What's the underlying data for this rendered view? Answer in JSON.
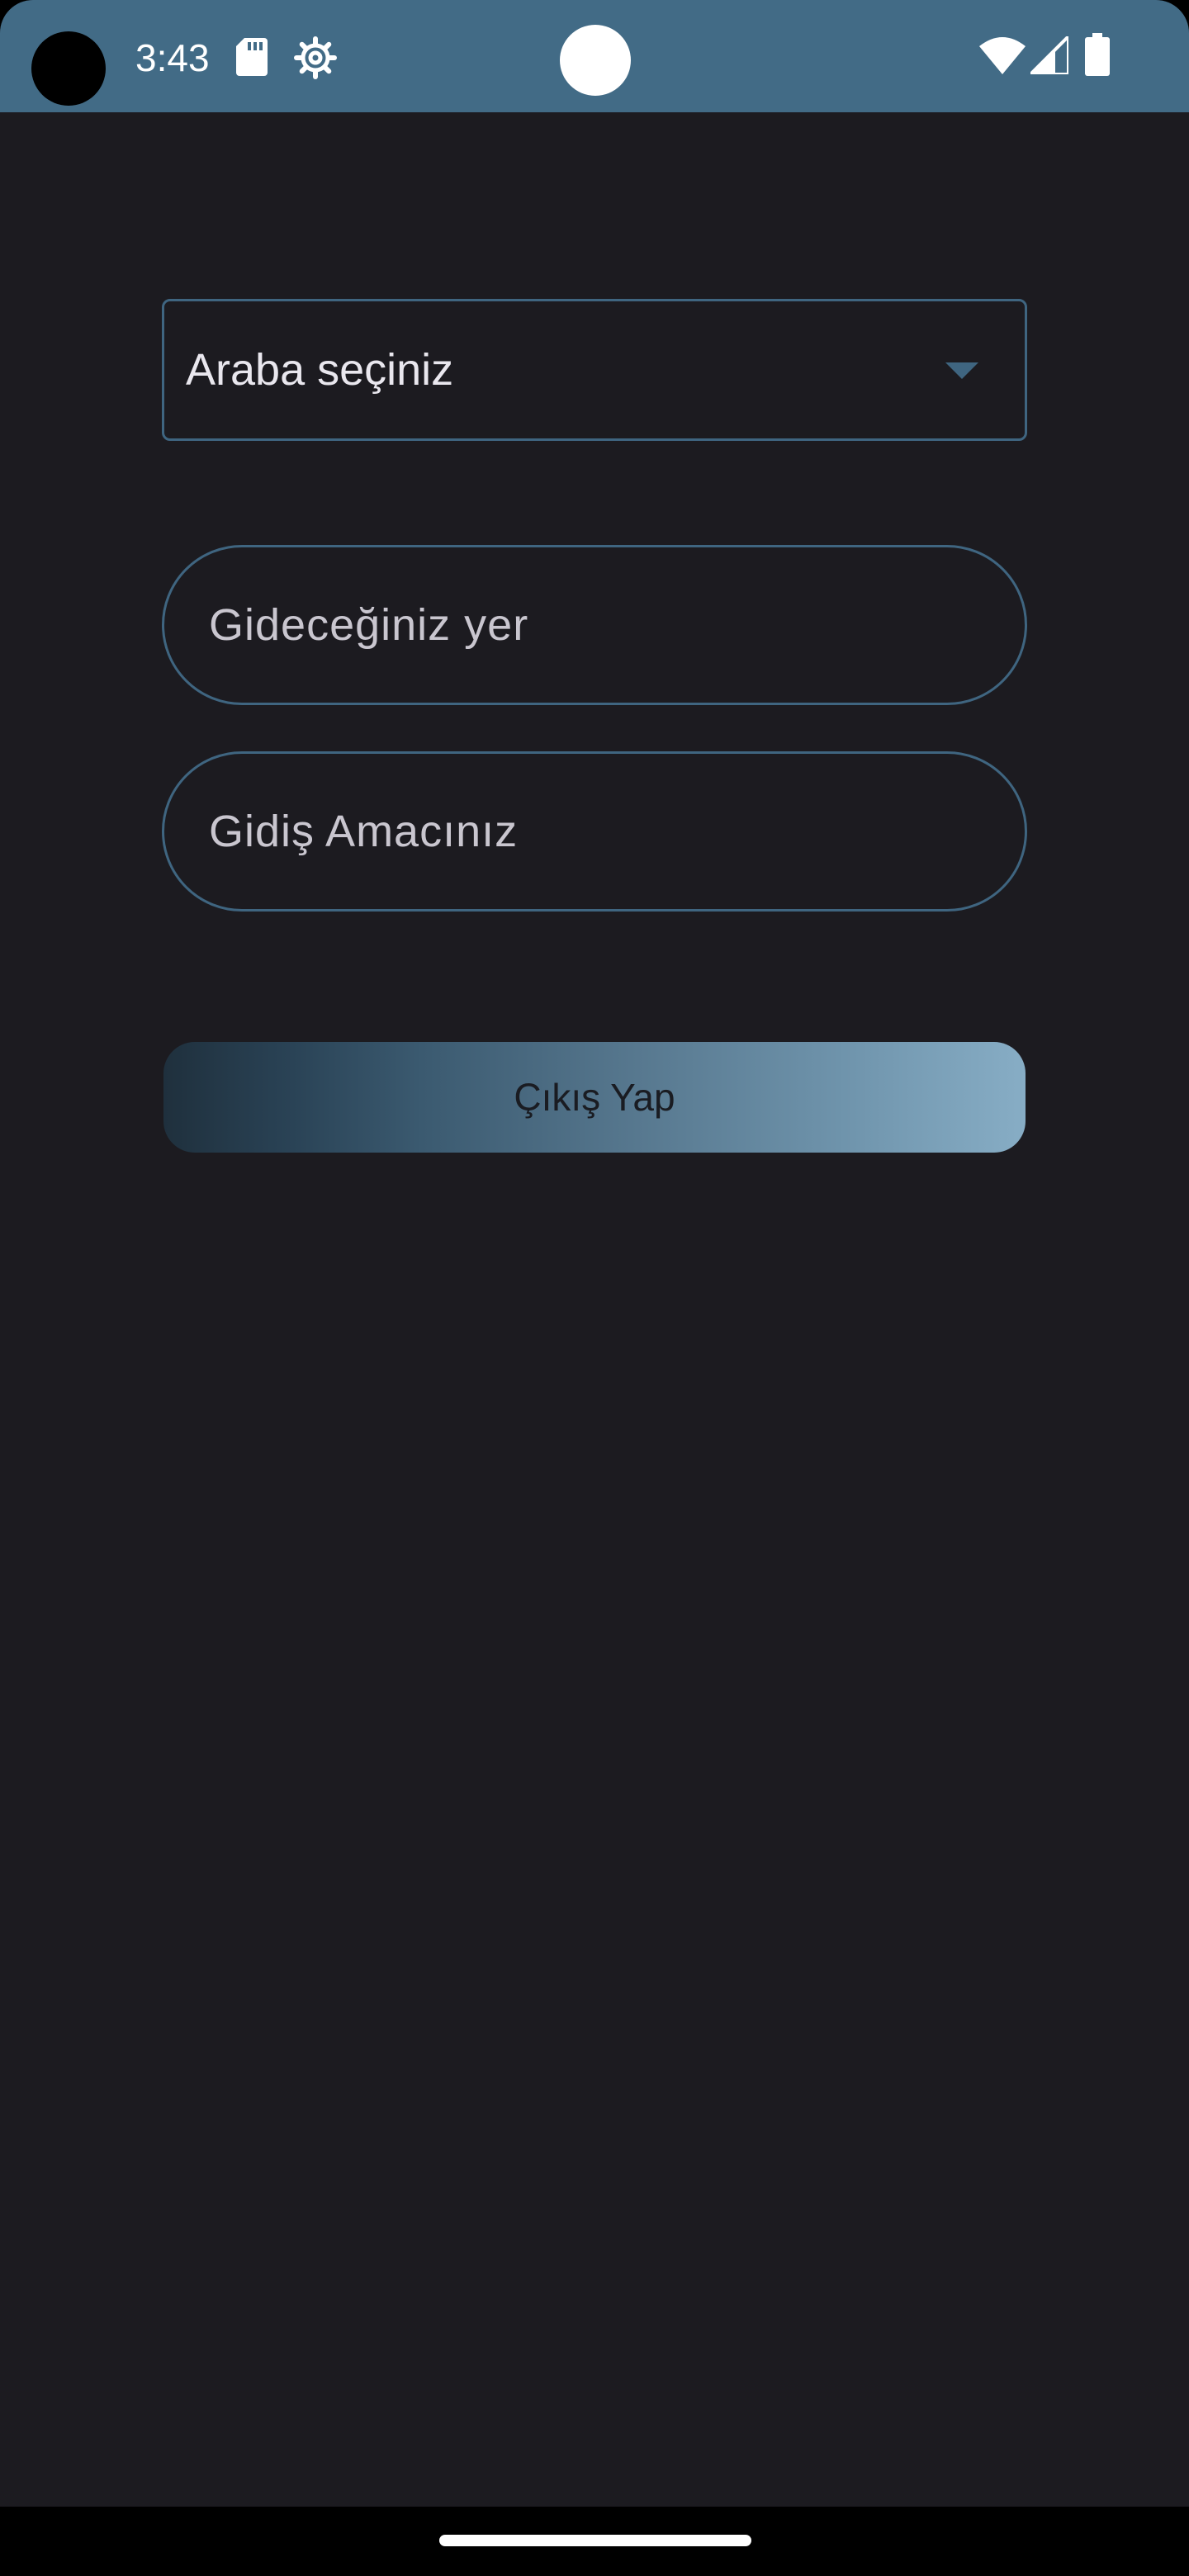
{
  "status_bar": {
    "time": "3:43",
    "icons": [
      "sd-card-icon",
      "gear-icon",
      "wifi-icon",
      "signal-icon",
      "battery-icon"
    ]
  },
  "form": {
    "car_select": {
      "value": "Araba seçiniz"
    },
    "destination_field": {
      "placeholder": "Gideceğiniz yer"
    },
    "purpose_field": {
      "placeholder": "Gidiş Amacınız"
    },
    "logout_button": {
      "label": "Çıkış Yap"
    }
  },
  "colors": {
    "status_bar": "#426b86",
    "background": "#1c1b20",
    "outline": "#3f6580",
    "button_gradient_start": "#1f303d",
    "button_gradient_end": "#87adc5"
  }
}
